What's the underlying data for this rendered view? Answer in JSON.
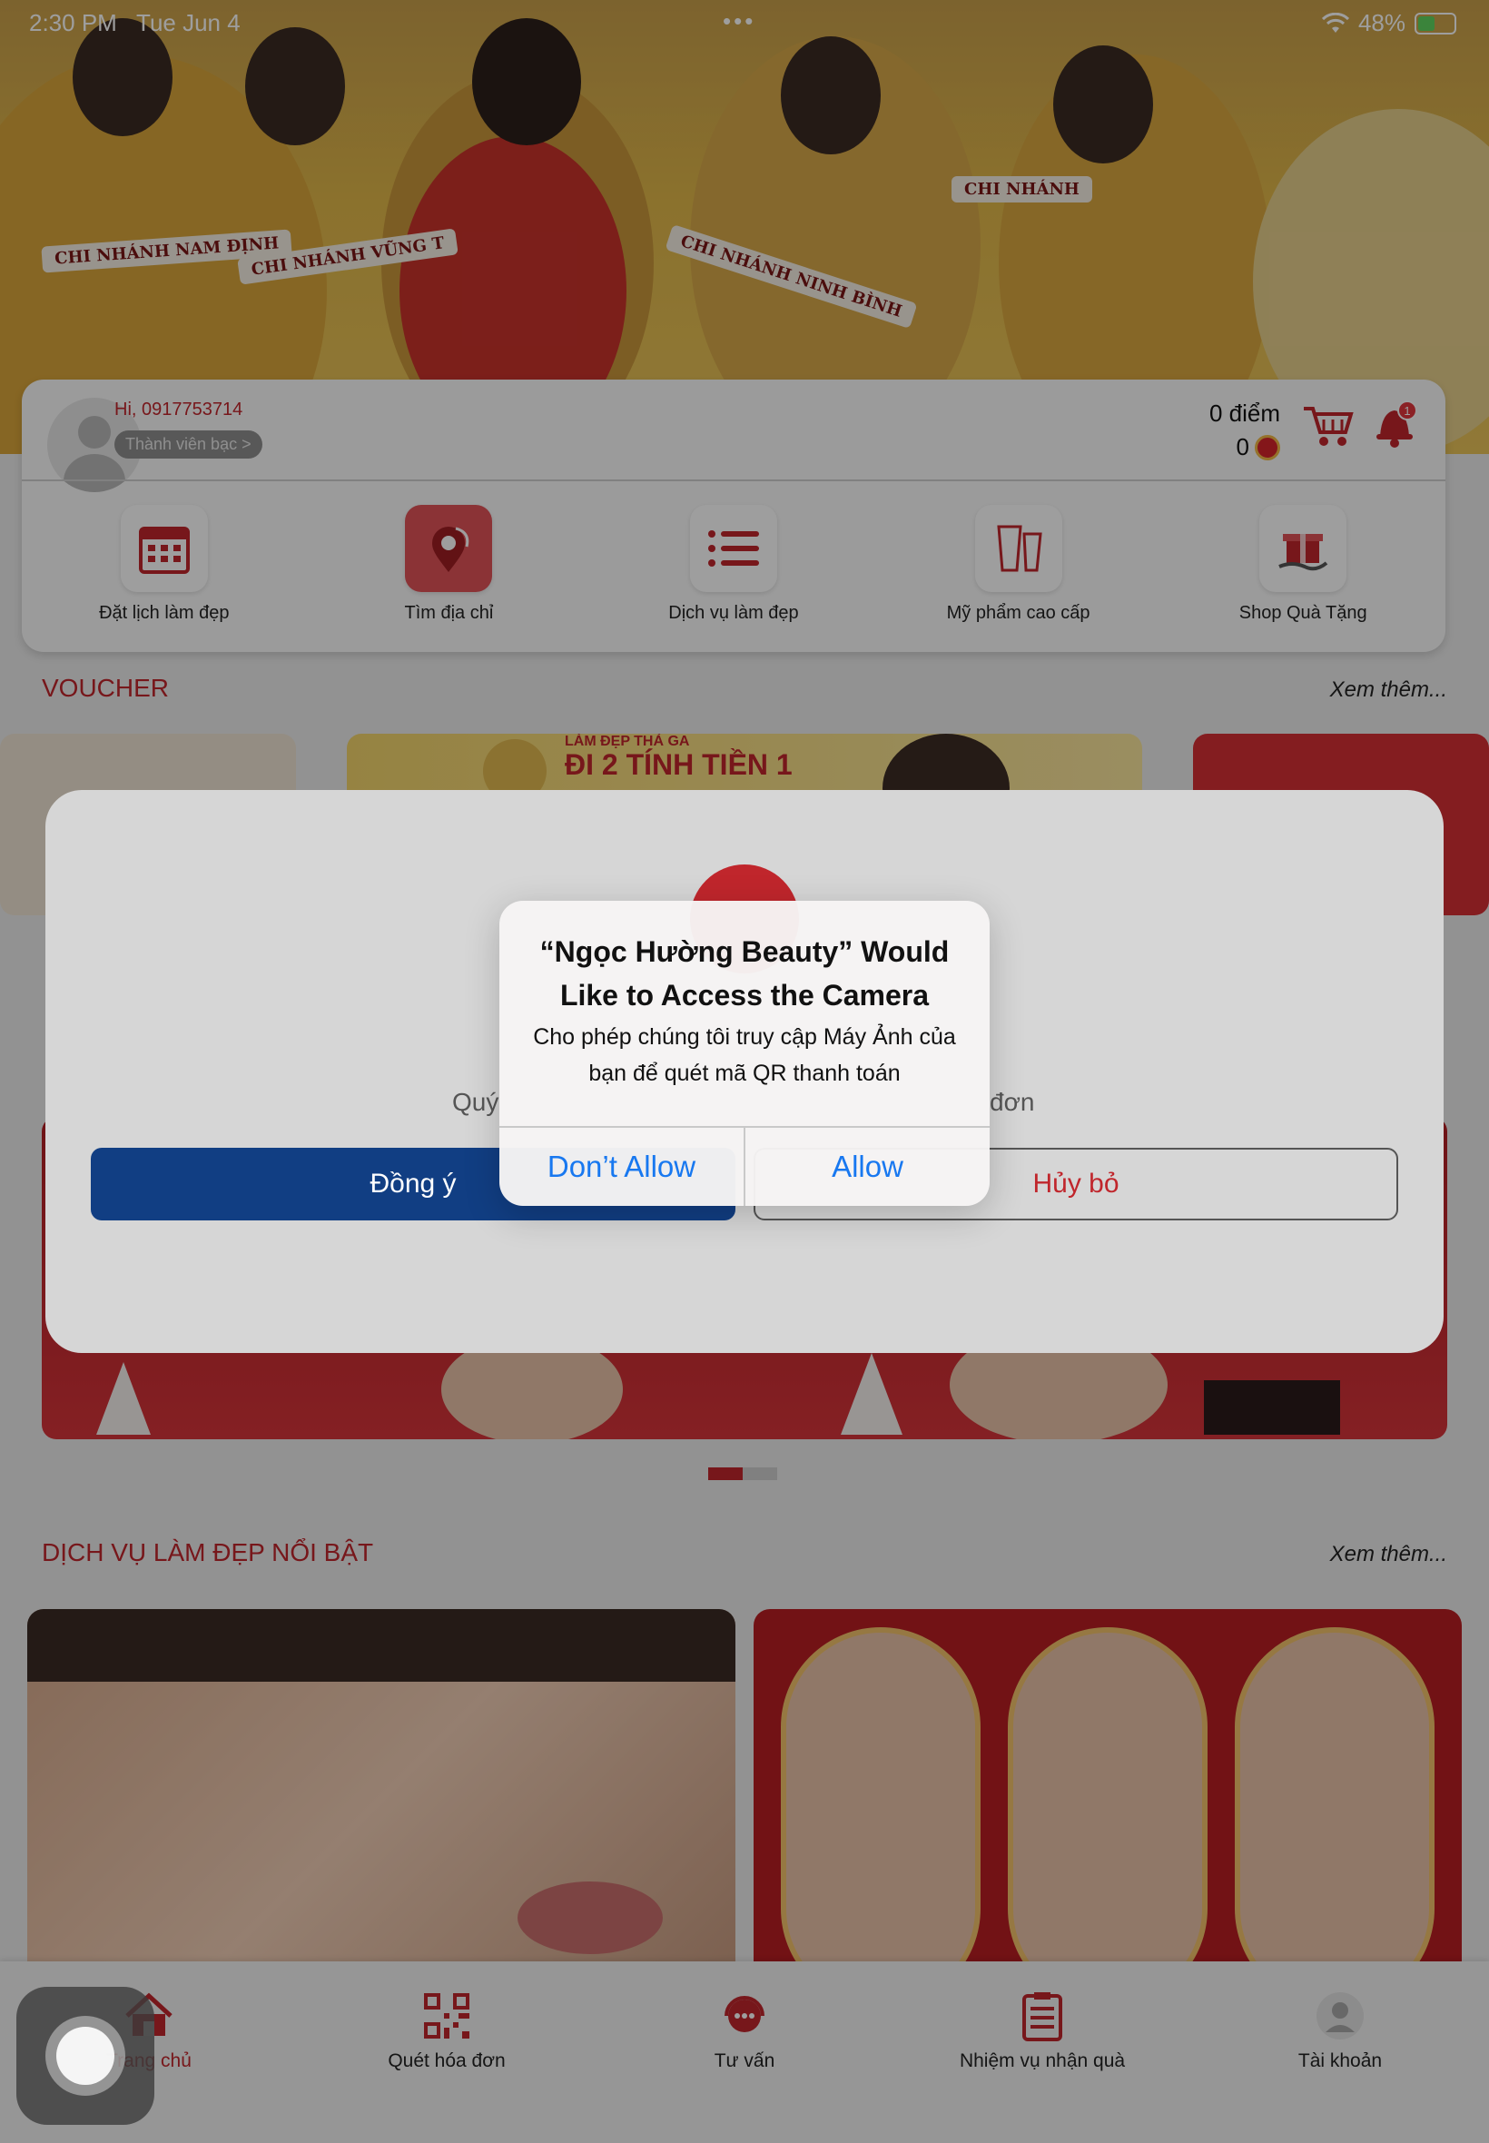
{
  "status_bar": {
    "time": "2:30 PM",
    "date": "Tue Jun 4",
    "dots": "•••",
    "battery": "48%",
    "battery_level": 0.48
  },
  "member": {
    "greeting": "Hi, 0917753714",
    "tier": "Thành viên bạc >",
    "points": "0 điểm",
    "coins": "0",
    "notification_count": "1"
  },
  "menu": [
    {
      "label": "Đặt lịch làm đẹp",
      "icon": "calendar-icon"
    },
    {
      "label": "Tìm địa chỉ",
      "icon": "map-pin-icon"
    },
    {
      "label": "Dịch vụ làm đẹp",
      "icon": "list-icon"
    },
    {
      "label": "Mỹ phẩm cao cấp",
      "icon": "cosmetics-icon"
    },
    {
      "label": "Shop Quà Tặng",
      "icon": "gift-icon"
    }
  ],
  "voucher": {
    "title": "VOUCHER",
    "see_more": "Xem thêm...",
    "promo_small": "LÀM ĐẸP THẢ GA",
    "promo_big": "ĐI 2 TÍNH TIỀN 1"
  },
  "services": {
    "title": "DỊCH VỤ LÀM ĐẸP NỔI BẬT",
    "see_more": "Xem thêm..."
  },
  "hero_banners": [
    "CHI NHÁNH NAM ĐỊNH",
    "CHI NHÁNH VŨNG T",
    "CHI NHÁNH NINH BÌNH",
    "CHI NHÁNH"
  ],
  "app_dialog": {
    "message_left": "Quý",
    "message_right": "đơn",
    "agree": "Đồng ý",
    "cancel": "Hủy bỏ"
  },
  "ios_alert": {
    "title": "“Ngọc Hường Beauty” Would Like to Access the Camera",
    "body": "Cho phép chúng tôi truy cập Máy Ảnh của bạn để quét mã QR thanh toán",
    "deny": "Don’t Allow",
    "allow": "Allow"
  },
  "tabs": [
    {
      "label": "Trang chủ",
      "icon": "home-icon",
      "active": true
    },
    {
      "label": "Quét hóa đơn",
      "icon": "qr-code-icon",
      "active": false
    },
    {
      "label": "Tư vấn",
      "icon": "chat-support-icon",
      "active": false
    },
    {
      "label": "Nhiệm vụ nhận quà",
      "icon": "clipboard-icon",
      "active": false
    },
    {
      "label": "Tài khoản",
      "icon": "user-icon",
      "active": false
    }
  ],
  "colors": {
    "brand_red": "#c0262c",
    "agree_blue": "#113e83",
    "ios_blue": "#1878f0"
  }
}
